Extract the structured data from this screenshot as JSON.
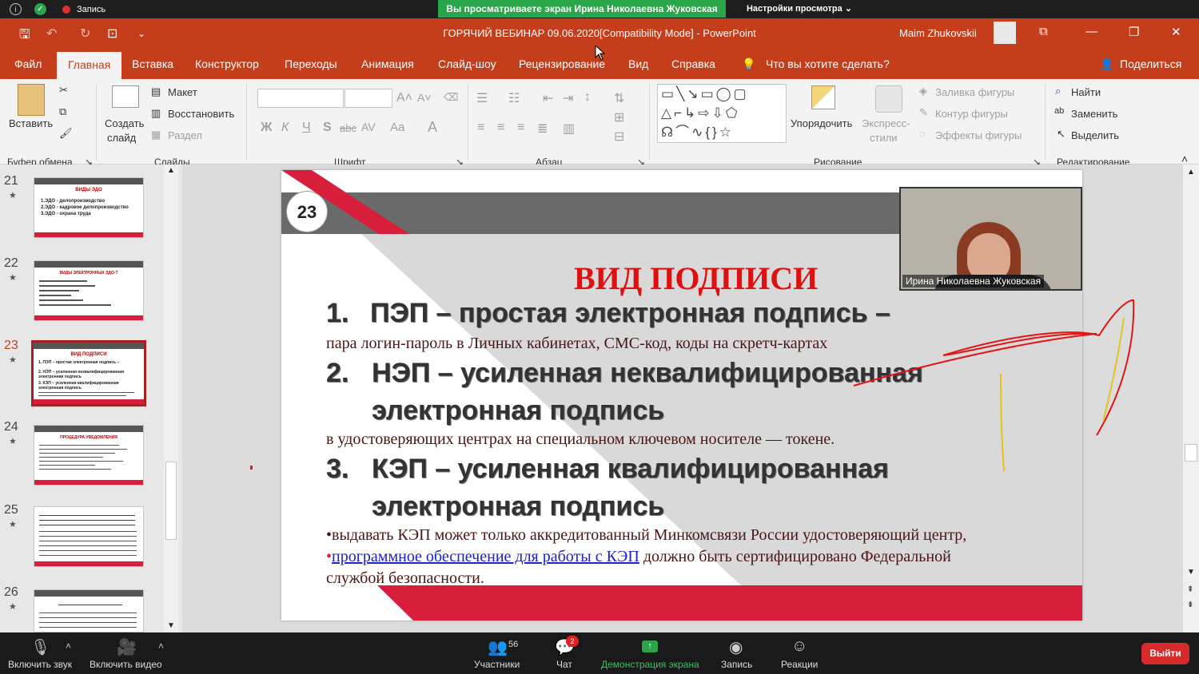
{
  "zoom_top": {
    "record_label": "Запись",
    "banner": "Вы просматриваете экран Ирина Николаевна Жуковская",
    "view_options": "Настройки просмотра"
  },
  "window": {
    "title": "ГОРЯЧИЙ ВЕБИНАР 09.06.2020[Compatibility Mode]  -  PowerPoint",
    "user": "Maim Zhukovskii"
  },
  "tabs": [
    "Файл",
    "Главная",
    "Вставка",
    "Конструктор",
    "Переходы",
    "Анимация",
    "Слайд-шоу",
    "Рецензирование",
    "Вид",
    "Справка"
  ],
  "tell_me": "Что вы хотите сделать?",
  "share": "Поделиться",
  "ribbon": {
    "paste": "Вставить",
    "new_slide_1": "Создать",
    "new_slide_2": "слайд",
    "layout": "Макет",
    "reset": "Восстановить",
    "section": "Раздел",
    "arrange": "Упорядочить",
    "quick_styles_1": "Экспресс-",
    "quick_styles_2": "стили",
    "shape_fill": "Заливка фигуры",
    "shape_outline": "Контур фигуры",
    "shape_effects": "Эффекты фигуры",
    "find": "Найти",
    "replace": "Заменить",
    "select": "Выделить",
    "font_bold": "Ж",
    "font_italic": "К",
    "font_underline": "Ч",
    "font_shadow": "S",
    "font_strike": "abc",
    "font_spacing": "AV",
    "font_case": "Aa",
    "groups": {
      "clipboard": "Буфер обмена",
      "slides": "Слайды",
      "font": "Шрифт",
      "paragraph": "Абзац",
      "drawing": "Рисование",
      "editing": "Редактирование"
    }
  },
  "thumbnails": [
    {
      "num": "21",
      "title": "ВИДЫ ЭДО",
      "lines": [
        "1.ЭДО - делопроизводство",
        "2.ЭДО - кадровое делопроизводство",
        "3.ЭДО - охрана труда"
      ]
    },
    {
      "num": "22",
      "title": "ВИДЫ ЭЛЕКТРОННЫХ ЭДО-Т",
      "lines": []
    },
    {
      "num": "23",
      "title": "ВИД ПОДПИСИ",
      "lines": [
        "1.  ПЭП – простая электронная подпись –",
        "2.  НЭП – усиленная неквалифицированная электронная подпись",
        "3.  КЭП – усиленная квалифицированная электронная подпись"
      ]
    },
    {
      "num": "24",
      "title": "ПРОЦЕДУРА УВЕДОМЛЕНИЯ",
      "lines": []
    },
    {
      "num": "25",
      "title": "",
      "lines": []
    },
    {
      "num": "26",
      "title": "",
      "lines": []
    }
  ],
  "slide": {
    "number": "23",
    "title": "ВИД  ПОДПИСИ",
    "item1_num": "1.",
    "item1": "ПЭП – простая электронная подпись –",
    "item1_sub": "пара логин-пароль в Личных кабинетах, СМС-код, коды на скретч-картах",
    "item2_num": "2.",
    "item2_a": "НЭП – усиленная неквалифицированная",
    "item2_b": "электронная подпись",
    "item2_sub": "в удостоверяющих центрах на специальном ключевом носителе — токене.",
    "item3_num": "3.",
    "item3_a": "КЭП – усиленная квалифицированная",
    "item3_b": "электронная подпись",
    "bullet1": "выдавать КЭП может только аккредитованный Минкомсвязи России удостоверяющий центр,",
    "bullet2_link": "программное обеспечение для работы с КЭП",
    "bullet2_rest": " должно быть сертифицировано Федеральной",
    "bullet2_cont": "службой безопасности."
  },
  "video": {
    "name": "Ирина Николаевна Жуковская"
  },
  "zoom_bottom": {
    "mute": "Включить звук",
    "video": "Включить видео",
    "participants": "Участники",
    "participants_count": "56",
    "chat": "Чат",
    "chat_badge": "2",
    "share": "Демонстрация экрана",
    "record": "Запись",
    "reactions": "Реакции",
    "leave": "Выйти"
  },
  "colors": {
    "ppt_accent": "#c43e1c",
    "slide_red": "#d71f3b",
    "zoom_green": "#2aa64a"
  }
}
